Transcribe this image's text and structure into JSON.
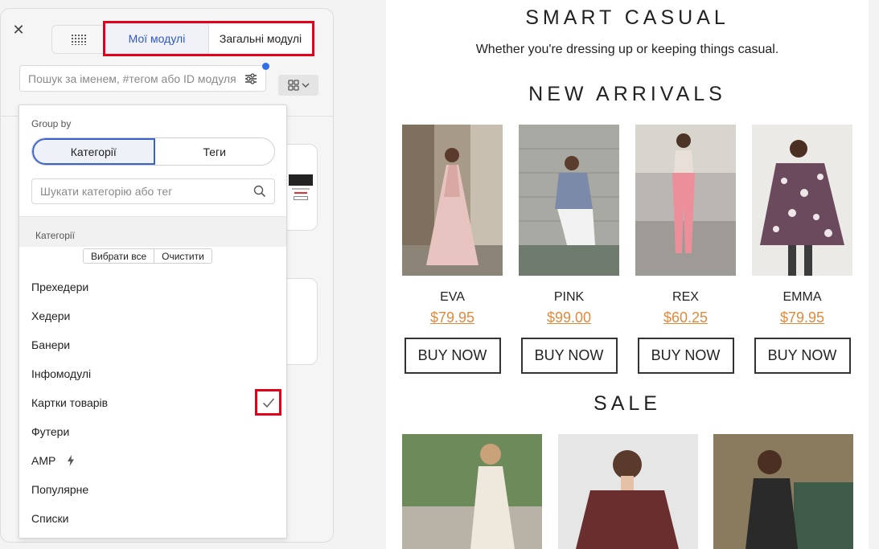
{
  "panel": {
    "close": "✕",
    "tabs": [
      {
        "label": "Мої модулі",
        "active": true
      },
      {
        "label": "Загальні модулі",
        "active": false
      }
    ],
    "search_placeholder": "Пошук за іменем, #тегом або ID модуля"
  },
  "dropdown": {
    "group_by": "Group by",
    "segments": [
      "Категорії",
      "Теги"
    ],
    "cat_search_placeholder": "Шукати категорію або тег",
    "section_title": "Категорії",
    "select_all": "Вибрати все",
    "clear": "Очистити",
    "categories": [
      {
        "label": "Прехедери",
        "checked": false
      },
      {
        "label": "Хедери",
        "checked": false
      },
      {
        "label": "Банери",
        "checked": false
      },
      {
        "label": "Інфомодулі",
        "checked": false
      },
      {
        "label": "Картки товарів",
        "checked": true
      },
      {
        "label": "Футери",
        "checked": false
      },
      {
        "label": "AMP",
        "checked": false,
        "icon": "lightning-icon"
      },
      {
        "label": "Популярне",
        "checked": false
      },
      {
        "label": "Списки",
        "checked": false
      }
    ]
  },
  "preview": {
    "heading1": "SMART CASUAL",
    "subtitle": "Whether you're dressing up or keeping things casual.",
    "heading2": "NEW ARRIVALS",
    "products": [
      {
        "name": "EVA",
        "price": "$79.95",
        "button": "BUY NOW"
      },
      {
        "name": "PINK",
        "price": "$99.00",
        "button": "BUY NOW"
      },
      {
        "name": "REX",
        "price": "$60.25",
        "button": "BUY NOW"
      },
      {
        "name": "EMMA",
        "price": "$79.95",
        "button": "BUY NOW"
      }
    ],
    "heading3": "SALE"
  },
  "colors": {
    "accent_blue": "#2f57c9",
    "highlight_red": "#e3001b",
    "price_orange": "#e08a3c"
  }
}
